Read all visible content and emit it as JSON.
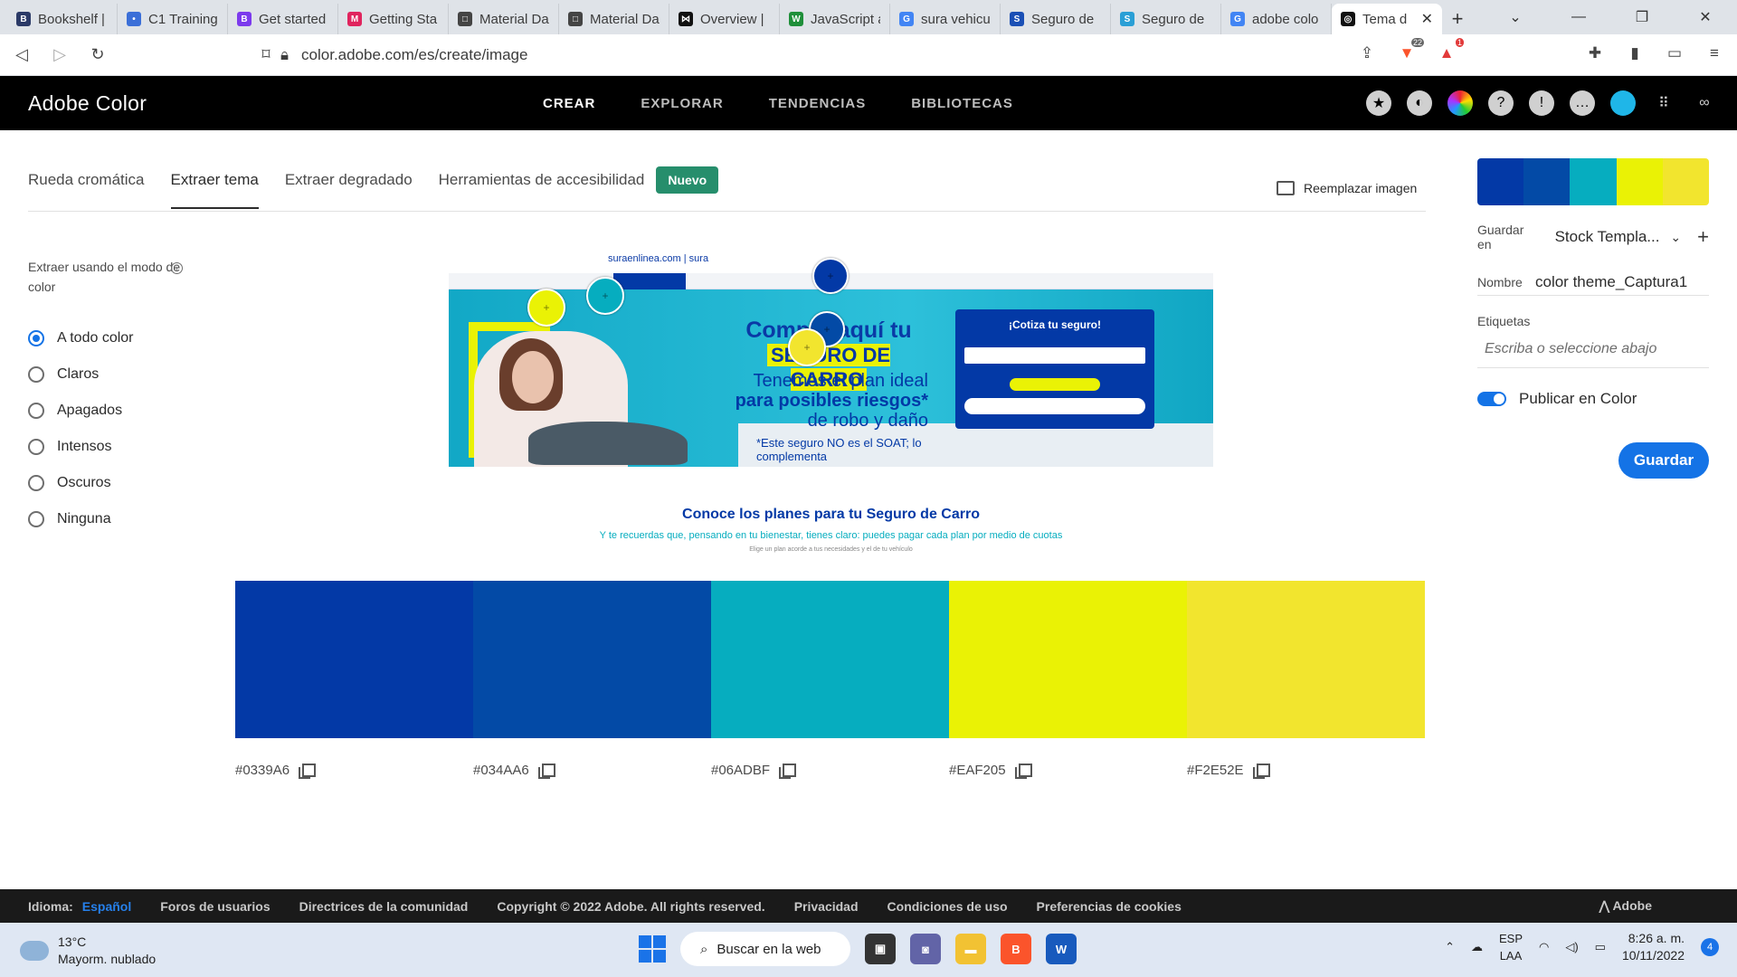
{
  "browser": {
    "tabs": [
      {
        "title": "Bookshelf |",
        "fav_color": "#2b3a67",
        "fav_glyph": "B"
      },
      {
        "title": "C1 Training",
        "fav_color": "#3b6fd8",
        "fav_glyph": "•"
      },
      {
        "title": "Get started",
        "fav_color": "#7c3aed",
        "fav_glyph": "B"
      },
      {
        "title": "Getting Sta",
        "fav_color": "#e0245e",
        "fav_glyph": "M"
      },
      {
        "title": "Material Da",
        "fav_color": "#444444",
        "fav_glyph": "□"
      },
      {
        "title": "Material Da",
        "fav_color": "#444444",
        "fav_glyph": "□"
      },
      {
        "title": "Overview |",
        "fav_color": "#111111",
        "fav_glyph": "⋈"
      },
      {
        "title": "JavaScript a",
        "fav_color": "#1f8f3a",
        "fav_glyph": "W"
      },
      {
        "title": "sura vehicu",
        "fav_color": "#4285f4",
        "fav_glyph": "G"
      },
      {
        "title": "Seguro de",
        "fav_color": "#1a4fb5",
        "fav_glyph": "S"
      },
      {
        "title": "Seguro de",
        "fav_color": "#2a9fd6",
        "fav_glyph": "S"
      },
      {
        "title": "adobe colo",
        "fav_color": "#4285f4",
        "fav_glyph": "G"
      },
      {
        "title": "Tema d",
        "fav_color": "#111111",
        "fav_glyph": "◎",
        "active": true
      }
    ],
    "url": "color.adobe.com/es/create/image",
    "ext_badge_1": "22",
    "ext_badge_2": "1"
  },
  "app": {
    "brand": "Adobe Color",
    "nav": [
      "CREAR",
      "EXPLORAR",
      "TENDENCIAS",
      "BIBLIOTECAS"
    ],
    "subtabs": [
      "Rueda cromática",
      "Extraer tema",
      "Extraer degradado",
      "Herramientas de accesibilidad"
    ],
    "new_badge": "Nuevo",
    "replace_image": "Reemplazar imagen"
  },
  "left_panel": {
    "label": "Extraer usando el modo de color",
    "options": [
      "A todo color",
      "Claros",
      "Apagados",
      "Intensos",
      "Oscuros",
      "Ninguna"
    ],
    "selected": "A todo color"
  },
  "image": {
    "site_logo": "suraenlinea.com | sura",
    "headline": "Compra aquí tu",
    "headline_highlight": "SEGURO DE CARRO",
    "sub1": "Tenemos el plan ideal",
    "sub2": "para posibles riesgos*",
    "sub3": "de robo y daño",
    "form_title": "¡Cotiza tu seguro!",
    "note": "*Este seguro NO es el SOAT; lo complementa",
    "bottom_title": "Conoce los planes para tu Seguro de Carro",
    "bottom_sub": "Y te recuerdas que, pensando en tu bienestar, tienes claro: puedes pagar cada plan por medio de cuotas",
    "bottom_fine": "Elige un plan acorde a tus necesidades y el de tu vehículo"
  },
  "palette": [
    {
      "hex": "#0339A6"
    },
    {
      "hex": "#034AA6"
    },
    {
      "hex": "#06ADBF"
    },
    {
      "hex": "#EAF205"
    },
    {
      "hex": "#F2E52E"
    }
  ],
  "right_panel": {
    "save_in_label": "Guardar en",
    "save_in_value": "Stock Templa...",
    "name_label": "Nombre",
    "name_value": "color theme_Captura1",
    "tags_label": "Etiquetas",
    "tags_placeholder": "Escriba o seleccione abajo",
    "publish_label": "Publicar en Color",
    "save_button": "Guardar"
  },
  "footer": {
    "language_label": "Idioma:",
    "language_value": "Español",
    "links": [
      "Foros de usuarios",
      "Directrices de la comunidad",
      "Copyright © 2022 Adobe. All rights reserved.",
      "Privacidad",
      "Condiciones de uso",
      "Preferencias de cookies"
    ],
    "adobe": "Adobe"
  },
  "taskbar": {
    "temp": "13°C",
    "weather": "Mayorm. nublado",
    "search": "Buscar en la web",
    "lang_line1": "ESP",
    "lang_line2": "LAA",
    "time": "8:26 a. m.",
    "date": "10/11/2022",
    "notifications": "4"
  }
}
